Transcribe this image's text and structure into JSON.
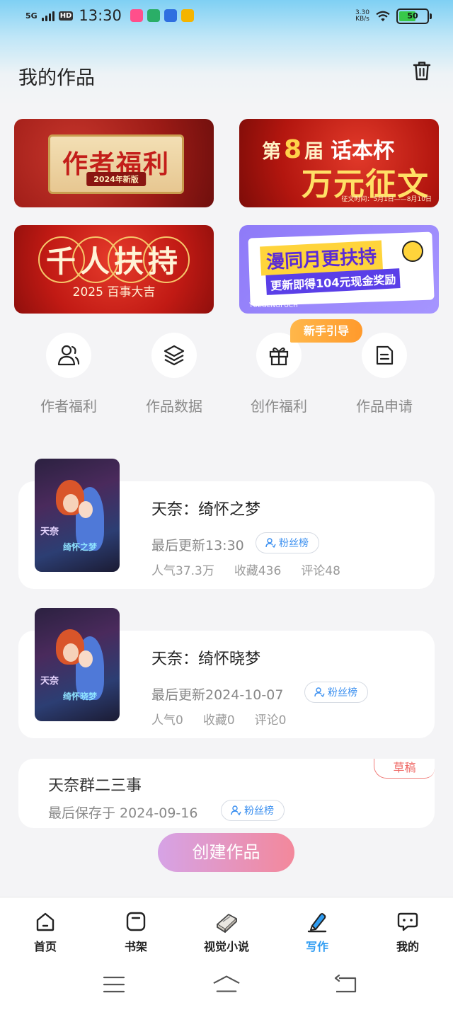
{
  "status_bar": {
    "network": "5G",
    "hd": "HD",
    "time": "13:30",
    "speed_value": "3.30",
    "speed_unit": "KB/s",
    "battery": "50",
    "app_icons": [
      {
        "name": "app-icon-pink",
        "color": "#ff4f8b"
      },
      {
        "name": "wechat-icon",
        "color": "#2aae67"
      },
      {
        "name": "app-icon-blue",
        "color": "#2f6fe0"
      },
      {
        "name": "app-icon-yellow",
        "color": "#f5b400"
      }
    ]
  },
  "header": {
    "title": "我的作品",
    "trash_icon": "trash-icon"
  },
  "banners": {
    "author_welfare": {
      "title": "作者福利",
      "sub": "2024年新版"
    },
    "contest": {
      "prefix": "第",
      "number": "8",
      "suffix": "届",
      "cup": "话本杯",
      "big": "万元征文",
      "date": "征文时间：5月1日——8月10日"
    },
    "thousand": {
      "title": "千人扶持",
      "sub": "2025 百事大吉"
    },
    "monthly": {
      "title": "漫同月更扶持",
      "sub": "更新即得104元现金奖励",
      "tag": "YUEGENGFUCH"
    }
  },
  "quick_actions": [
    {
      "label": "作者福利",
      "icon": "users-icon"
    },
    {
      "label": "作品数据",
      "icon": "layers-icon"
    },
    {
      "label": "创作福利",
      "icon": "gift-icon"
    },
    {
      "label": "作品申请",
      "icon": "document-icon"
    }
  ],
  "guide_badge": "新手引导",
  "works": [
    {
      "title": "天奈：绮怀之梦",
      "updated": "最后更新13:30",
      "fans": "粉丝榜",
      "popularity": "人气37.3万",
      "favorites": "收藏436",
      "comments": "评论48",
      "cover_text": "天奈",
      "cover_text2": "绮怀之梦"
    },
    {
      "title": "天奈：绮怀晓梦",
      "updated": "最后更新2024-10-07",
      "fans": "粉丝榜",
      "popularity": "人气0",
      "favorites": "收藏0",
      "comments": "评论0",
      "cover_text": "天奈",
      "cover_text2": "绮怀晓梦"
    }
  ],
  "draft": {
    "title": "天奈群二三事",
    "saved": "最后保存于 2024-09-16",
    "fans": "粉丝榜",
    "badge": "草稿"
  },
  "create_button": "创建作品",
  "bottom_nav": [
    {
      "label": "首页",
      "icon": "home-icon",
      "active": false
    },
    {
      "label": "书架",
      "icon": "bookshelf-icon",
      "active": false
    },
    {
      "label": "视觉小说",
      "icon": "book-icon",
      "active": false
    },
    {
      "label": "写作",
      "icon": "pen-icon",
      "active": true
    },
    {
      "label": "我的",
      "icon": "chat-bubble-icon",
      "active": false
    }
  ],
  "colors": {
    "accent": "#2e9cf2",
    "badge_orange": "#ff9a2c",
    "draft_red": "#ef6966"
  }
}
